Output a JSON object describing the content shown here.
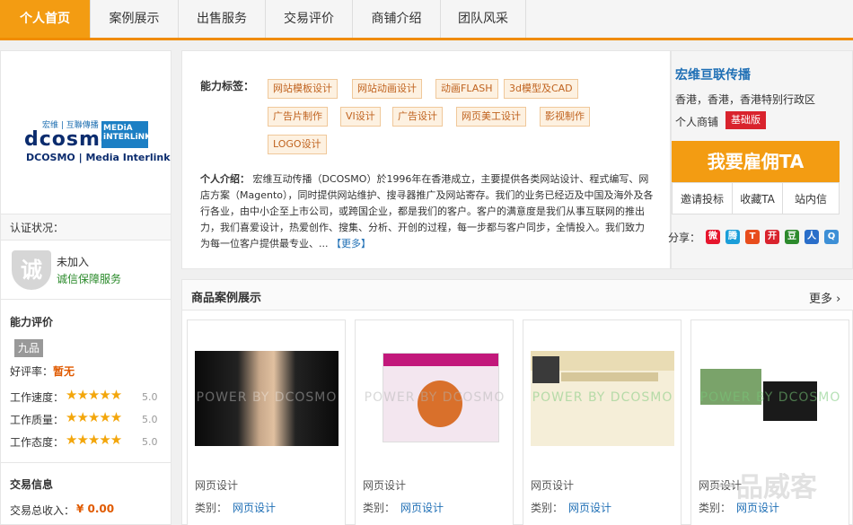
{
  "nav": {
    "tabs": [
      "个人首页",
      "案例展示",
      "出售服务",
      "交易评价",
      "商铺介绍",
      "团队风采"
    ],
    "active_index": 0
  },
  "sidebar": {
    "logo": {
      "line1": "宏维 | 互聯傳播",
      "line2": "dcosmo",
      "line3": "MEDiA iNTERLiNK",
      "line4": "DCOSMO | Media Interlink"
    },
    "cert": {
      "title": "认证状况：",
      "shield_glyph": "诚",
      "status": "未加入",
      "link": "诚信保障服务"
    },
    "rating": {
      "title": "能力评价",
      "level": "九品",
      "praise_label": "好评率：",
      "praise_value": "暂无",
      "items": [
        {
          "label": "工作速度：",
          "stars": "★★★★★",
          "score": "5.0"
        },
        {
          "label": "工作质量：",
          "stars": "★★★★★",
          "score": "5.0"
        },
        {
          "label": "工作态度：",
          "stars": "★★★★★",
          "score": "5.0"
        }
      ]
    },
    "trade": {
      "title": "交易信息",
      "income_label": "交易总收入：",
      "income_value": "¥ 0.00"
    }
  },
  "main": {
    "tags_label": "能力标签：",
    "tags": [
      "网站模板设计",
      "网站动画设计",
      "动画FLASH",
      "3d模型及CAD",
      "广告片制作",
      "VI设计",
      "广告设计",
      "网页美工设计",
      "影视制作",
      "LOGO设计"
    ],
    "intro_label": "个人介绍：",
    "intro_text": "宏维互动传播（DCOSMO）於1996年在香港成立，主要提供各类网站设计、程式编写、网店方案（Magento），同时提供网站维护、搜寻器推广及网站寄存。我们的业务已经迈及中国及海外及各行各业，由中小企至上市公司，或跨国企业，都是我们的客户。客户的满意度是我们从事互联网的推出力，我们喜爱设计，热爱创作、搜集、分析、开创的过程，每一步都与客户同步，全情投入。我们致力为每一位客户提供最专业、...",
    "more": "【更多】"
  },
  "shop": {
    "name": "宏维亘联传播",
    "location": "香港，香港，香港特别行政区",
    "type_label": "个人商铺",
    "type_badge": "基础版",
    "hire_button": "我要雇佣TA",
    "actions": [
      "邀请投标",
      "收藏TA",
      "站内信"
    ],
    "share_label": "分享：",
    "share_icons": [
      {
        "name": "weibo-icon",
        "glyph": "微",
        "color": "#e6162d"
      },
      {
        "name": "tencent-weibo-icon",
        "glyph": "腾",
        "color": "#1b9ed9"
      },
      {
        "name": "tianya-icon",
        "glyph": "T",
        "color": "#e84d1c"
      },
      {
        "name": "kaixin-icon",
        "glyph": "开",
        "color": "#d9232d"
      },
      {
        "name": "douban-icon",
        "glyph": "豆",
        "color": "#2c8a2c"
      },
      {
        "name": "renren-icon",
        "glyph": "人",
        "color": "#2a6ec9"
      },
      {
        "name": "qzone-icon",
        "glyph": "Q",
        "color": "#3d8fd6"
      }
    ]
  },
  "showcase": {
    "title": "商品案例展示",
    "more": "更多 ›",
    "watermark": "POWER BY DCOSMO",
    "cat_label": "类别：",
    "items": [
      {
        "title": "网页设计",
        "category": "网页设计"
      },
      {
        "title": "网页设计",
        "category": "网页设计"
      },
      {
        "title": "网页设计",
        "category": "网页设计"
      },
      {
        "title": "网页设计",
        "category": "网页设计"
      }
    ]
  },
  "footer_watermark": "一品威客"
}
